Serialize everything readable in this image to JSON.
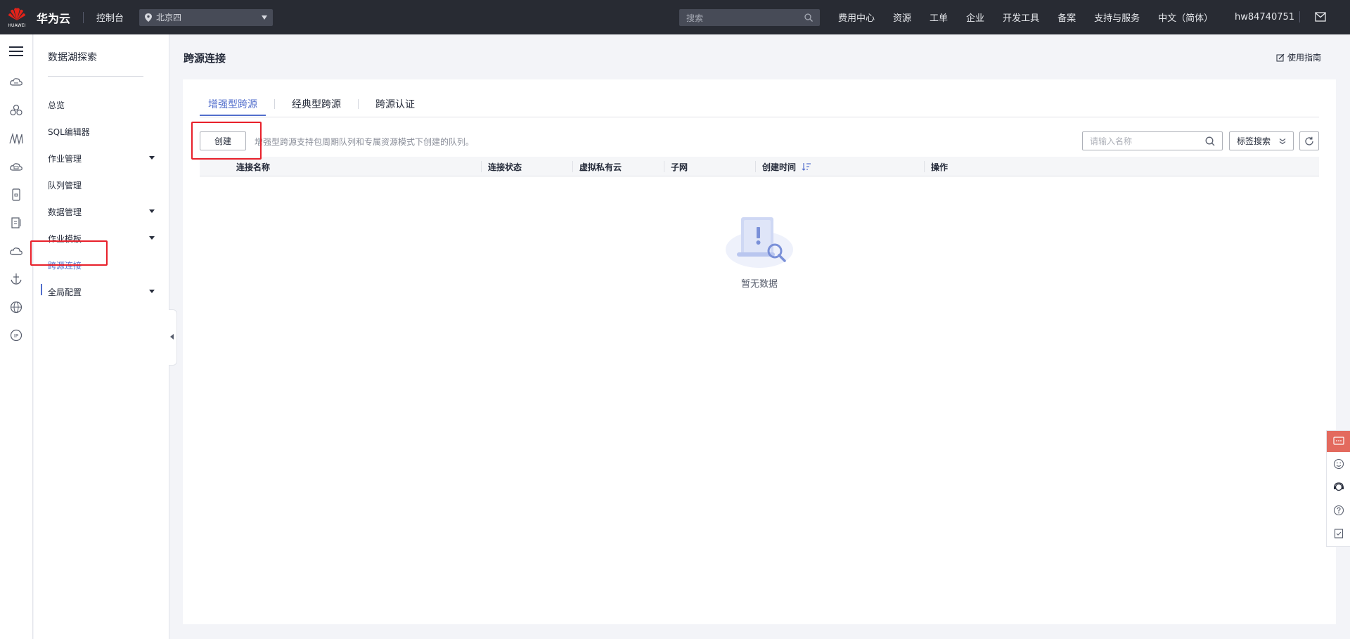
{
  "topbar": {
    "logo_text": "HUAWEI",
    "brand": "华为云",
    "console": "控制台",
    "region": "北京四",
    "search_placeholder": "搜索",
    "nav": [
      "费用中心",
      "资源",
      "工单",
      "企业",
      "开发工具",
      "备案",
      "支持与服务",
      "中文（简体）"
    ],
    "user": "hw84740751"
  },
  "sidebar": {
    "title": "数据湖探索",
    "items": [
      {
        "label": "总览",
        "expandable": false
      },
      {
        "label": "SQL编辑器",
        "expandable": false
      },
      {
        "label": "作业管理",
        "expandable": true
      },
      {
        "label": "队列管理",
        "expandable": false
      },
      {
        "label": "数据管理",
        "expandable": true
      },
      {
        "label": "作业模板",
        "expandable": true
      },
      {
        "label": "跨源连接",
        "expandable": false,
        "active": true
      },
      {
        "label": "全局配置",
        "expandable": true
      }
    ]
  },
  "main": {
    "title": "跨源连接",
    "guide": "使用指南",
    "tabs": [
      {
        "label": "增强型跨源",
        "active": true
      },
      {
        "label": "经典型跨源",
        "active": false
      },
      {
        "label": "跨源认证",
        "active": false
      }
    ],
    "create_label": "创建",
    "hint": "增强型跨源支持包周期队列和专属资源模式下创建的队列。",
    "name_search_placeholder": "请输入名称",
    "tag_search_label": "标签搜索",
    "columns": [
      "连接名称",
      "连接状态",
      "虚拟私有云",
      "子网",
      "创建时间",
      "操作"
    ],
    "empty_text": "暂无数据"
  },
  "colors": {
    "topbar_bg": "#282b33",
    "accent": "#526ecc",
    "highlight": "#e8202a",
    "float_accent": "#e36a5e"
  }
}
